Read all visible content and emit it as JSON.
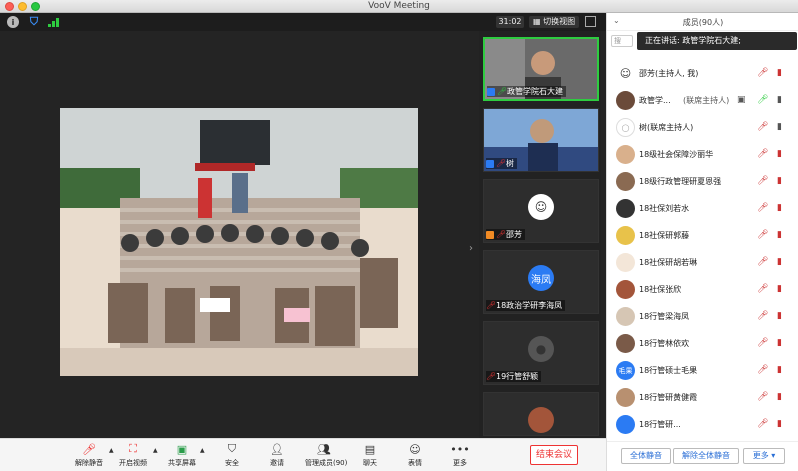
{
  "window": {
    "title": "VooV Meeting"
  },
  "topbar": {
    "timer": "31:02",
    "switch_view": "切换视图"
  },
  "thumbnails": [
    {
      "name": "政管学院石大建",
      "active": true
    },
    {
      "name": "树"
    },
    {
      "name": "邵芳"
    },
    {
      "name": "18政治学研李海凤",
      "avatar_text": "海凤"
    },
    {
      "name": "19行管舒颖"
    },
    {
      "name": ""
    }
  ],
  "toolbar": {
    "mute": "解除静音",
    "video": "开启视频",
    "share": "共享屏幕",
    "security": "安全",
    "invite": "邀请",
    "members": "管理成员(90)",
    "chat": "聊天",
    "reactions": "表情",
    "more": "更多",
    "end": "结束会议"
  },
  "panel": {
    "title": "成员(90人)",
    "search_placeholder": "搜",
    "speaking": "正在讲话: 政管学院石大建;",
    "members": [
      {
        "name": "邵芳(主持人, 我)"
      },
      {
        "name": "政管学...",
        "role": "(联席主持人)"
      },
      {
        "name": "树(联席主持人)"
      },
      {
        "name": "18级社会保障沙丽华"
      },
      {
        "name": "18级行政管理研夏恩强"
      },
      {
        "name": "18社保刘若水"
      },
      {
        "name": "18社保研郭藤"
      },
      {
        "name": "18社保研胡若琳"
      },
      {
        "name": "18社保张欣"
      },
      {
        "name": "18行管梁海凤"
      },
      {
        "name": "18行管林依欢"
      },
      {
        "name": "18行管硕士毛果",
        "avatar_text": "毛果"
      },
      {
        "name": "18行管研黄健霞"
      },
      {
        "name": "18行管研...",
        "avatar_text": ""
      }
    ],
    "mute_all": "全体静音",
    "unmute_all": "解除全体静音",
    "more": "更多"
  }
}
